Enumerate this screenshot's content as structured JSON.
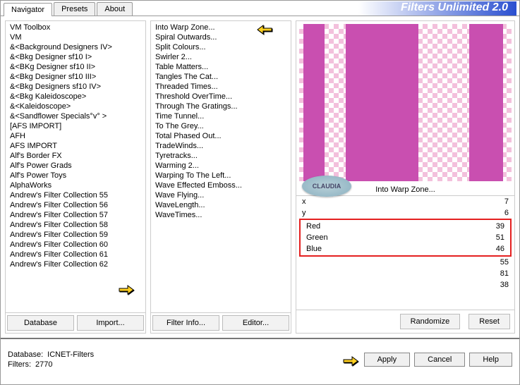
{
  "app_title": "Filters Unlimited 2.0",
  "tabs": [
    "Navigator",
    "Presets",
    "About"
  ],
  "col1": {
    "items": [
      "VM Toolbox",
      "VM",
      "&<Background Designers IV>",
      "&<Bkg Designer sf10 I>",
      "&<BKg Designer sf10 II>",
      "&<Bkg Designer sf10 III>",
      "&<Bkg Designers sf10 IV>",
      "&<Bkg Kaleidoscope>",
      "&<Kaleidoscope>",
      "&<Sandflower Specials°v° >",
      "[AFS IMPORT]",
      "AFH",
      "AFS IMPORT",
      "Alf's Border FX",
      "Alf's Power Grads",
      "Alf's Power Toys",
      "AlphaWorks",
      "Andrew's Filter Collection 55",
      "Andrew's Filter Collection 56",
      "Andrew's Filter Collection 57",
      "Andrew's Filter Collection 58",
      "Andrew's Filter Collection 59",
      "Andrew's Filter Collection 60",
      "Andrew's Filter Collection 61",
      "Andrew's Filter Collection 62"
    ],
    "buttons": [
      "Database",
      "Import..."
    ]
  },
  "col2": {
    "items": [
      "Into Warp Zone...",
      "Spiral Outwards...",
      "Split Colours...",
      "Swirler 2...",
      "Table Matters...",
      "Tangles The Cat...",
      "Threaded Times...",
      "Threshold OverTime...",
      "Through The Gratings...",
      "Time Tunnel...",
      "To The Grey...",
      "Total Phased Out...",
      "TradeWinds...",
      "Tyretracks...",
      "Warming 2...",
      "Warping To The Left...",
      "Wave Effected Emboss...",
      "Wave Flying...",
      "WaveLength...",
      "WaveTimes..."
    ],
    "buttons": [
      "Filter Info...",
      "Editor..."
    ]
  },
  "preview_title": "Into Warp Zone...",
  "watermark": "CLAUDIA",
  "sliders": {
    "top": [
      {
        "label": "x",
        "value": "7"
      },
      {
        "label": "y",
        "value": "6"
      }
    ],
    "rgb": [
      {
        "label": "Red",
        "value": "39"
      },
      {
        "label": "Green",
        "value": "51"
      },
      {
        "label": "Blue",
        "value": "46"
      }
    ],
    "bottom": [
      {
        "label": "",
        "value": "55"
      },
      {
        "label": "",
        "value": "81"
      },
      {
        "label": "",
        "value": "38"
      }
    ]
  },
  "col3_buttons": [
    "Randomize",
    "Reset"
  ],
  "footer": {
    "db_label": "Database:",
    "db_value": "ICNET-Filters",
    "filters_label": "Filters:",
    "filters_value": "2770",
    "buttons": [
      "Apply",
      "Cancel",
      "Help"
    ]
  }
}
